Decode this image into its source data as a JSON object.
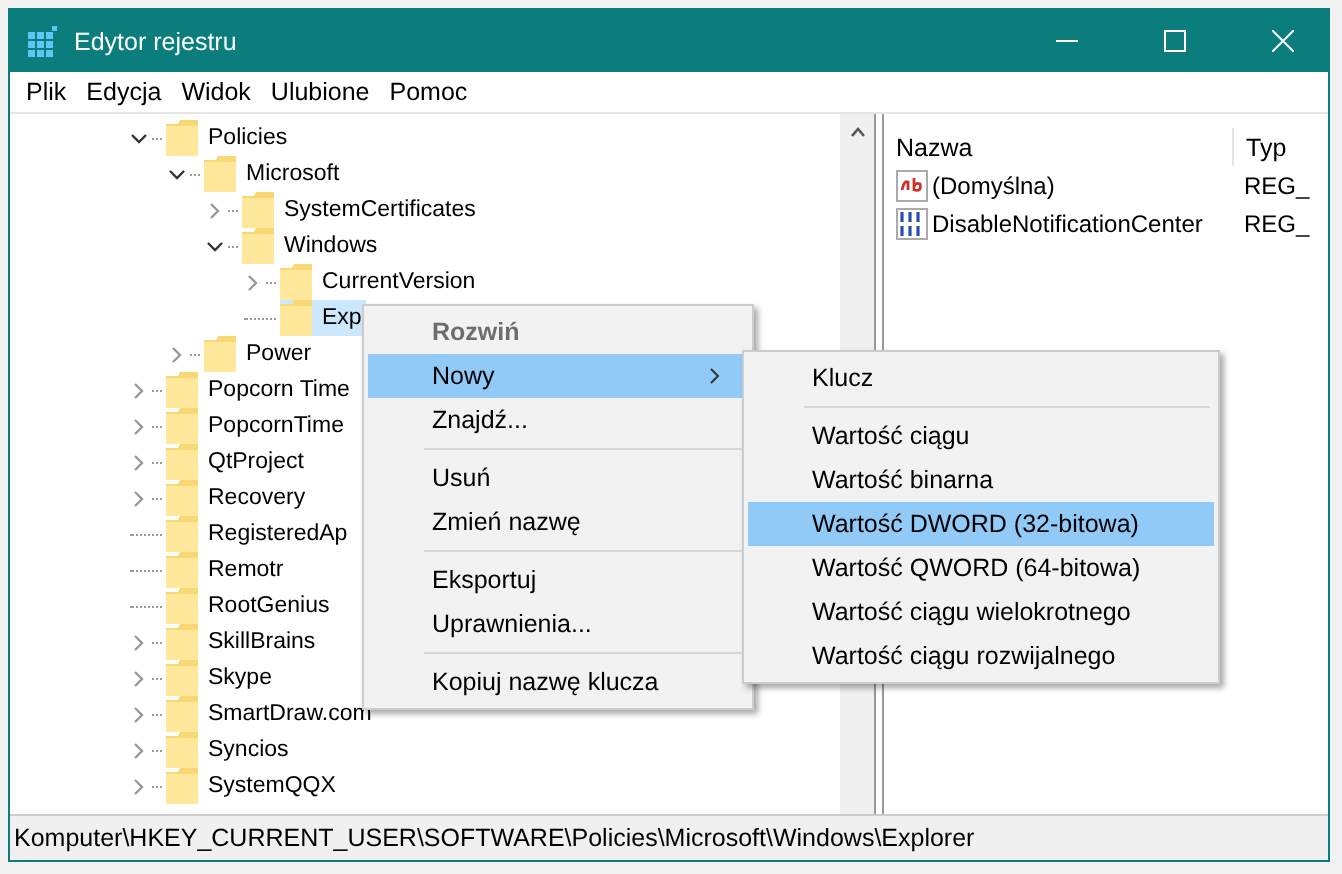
{
  "window": {
    "title": "Edytor rejestru"
  },
  "menu_bar": [
    "Plik",
    "Edycja",
    "Widok",
    "Ulubione",
    "Pomoc"
  ],
  "tree": [
    {
      "label": "Policies",
      "kind": "branch",
      "expanded": true,
      "selected": false,
      "children": [
        {
          "label": "Microsoft",
          "kind": "branch",
          "expanded": true,
          "selected": false,
          "children": [
            {
              "label": "SystemCertificates",
              "kind": "branch",
              "expanded": false,
              "selected": false
            },
            {
              "label": "Windows",
              "kind": "branch",
              "expanded": true,
              "selected": false,
              "children": [
                {
                  "label": "CurrentVersion",
                  "kind": "branch",
                  "expanded": false,
                  "selected": false
                },
                {
                  "label": "Exp",
                  "kind": "leaf",
                  "selected": true
                }
              ]
            }
          ]
        },
        {
          "label": "Power",
          "kind": "branch",
          "expanded": false,
          "selected": false
        }
      ]
    },
    {
      "label": "Popcorn Time",
      "kind": "branch",
      "expanded": false,
      "selected": false
    },
    {
      "label": "PopcornTime",
      "kind": "branch",
      "expanded": false,
      "selected": false
    },
    {
      "label": "QtProject",
      "kind": "branch",
      "expanded": false,
      "selected": false
    },
    {
      "label": "Recovery",
      "kind": "branch",
      "expanded": false,
      "selected": false
    },
    {
      "label": "RegisteredAp",
      "kind": "leaf",
      "selected": false
    },
    {
      "label": "Remotr",
      "kind": "leaf",
      "selected": false
    },
    {
      "label": "RootGenius",
      "kind": "leaf",
      "selected": false
    },
    {
      "label": "SkillBrains",
      "kind": "branch",
      "expanded": false,
      "selected": false
    },
    {
      "label": "Skype",
      "kind": "branch",
      "expanded": false,
      "selected": false
    },
    {
      "label": "SmartDraw.com",
      "kind": "branch",
      "expanded": false,
      "selected": false
    },
    {
      "label": "Syncios",
      "kind": "branch",
      "expanded": false,
      "selected": false
    },
    {
      "label": "SystemQQX",
      "kind": "branch",
      "expanded": false,
      "selected": false
    }
  ],
  "values": {
    "columns": [
      "Nazwa",
      "Typ"
    ],
    "rows": [
      {
        "kind": "string",
        "name": "(Domyślna)",
        "type": "REG_"
      },
      {
        "kind": "binary",
        "name": "DisableNotificationCenter",
        "type": "REG_"
      }
    ]
  },
  "context_menu": [
    {
      "kind": "item",
      "label": "Rozwiń",
      "default": true,
      "disabled": true,
      "selected": false,
      "submenu": false
    },
    {
      "kind": "item",
      "label": "Nowy",
      "default": false,
      "disabled": false,
      "selected": true,
      "submenu": true
    },
    {
      "kind": "item",
      "label": "Znajdź...",
      "default": false,
      "disabled": false,
      "selected": false,
      "submenu": false
    },
    {
      "kind": "separator"
    },
    {
      "kind": "item",
      "label": "Usuń",
      "default": false,
      "disabled": false,
      "selected": false,
      "submenu": false
    },
    {
      "kind": "item",
      "label": "Zmień nazwę",
      "default": false,
      "disabled": false,
      "selected": false,
      "submenu": false
    },
    {
      "kind": "separator"
    },
    {
      "kind": "item",
      "label": "Eksportuj",
      "default": false,
      "disabled": false,
      "selected": false,
      "submenu": false
    },
    {
      "kind": "item",
      "label": "Uprawnienia...",
      "default": false,
      "disabled": false,
      "selected": false,
      "submenu": false
    },
    {
      "kind": "separator"
    },
    {
      "kind": "item",
      "label": "Kopiuj nazwę klucza",
      "default": false,
      "disabled": false,
      "selected": false,
      "submenu": false
    }
  ],
  "submenu": [
    {
      "kind": "item",
      "label": "Klucz",
      "selected": false
    },
    {
      "kind": "separator"
    },
    {
      "kind": "item",
      "label": "Wartość ciągu",
      "selected": false
    },
    {
      "kind": "item",
      "label": "Wartość binarna",
      "selected": false
    },
    {
      "kind": "item",
      "label": "Wartość DWORD (32-bitowa)",
      "selected": true
    },
    {
      "kind": "item",
      "label": "Wartość QWORD (64-bitowa)",
      "selected": false
    },
    {
      "kind": "item",
      "label": "Wartość ciągu wielokrotnego",
      "selected": false
    },
    {
      "kind": "item",
      "label": "Wartość ciągu rozwijalnego",
      "selected": false
    }
  ],
  "status_bar": "Komputer\\HKEY_CURRENT_USER\\SOFTWARE\\Policies\\Microsoft\\Windows\\Explorer"
}
